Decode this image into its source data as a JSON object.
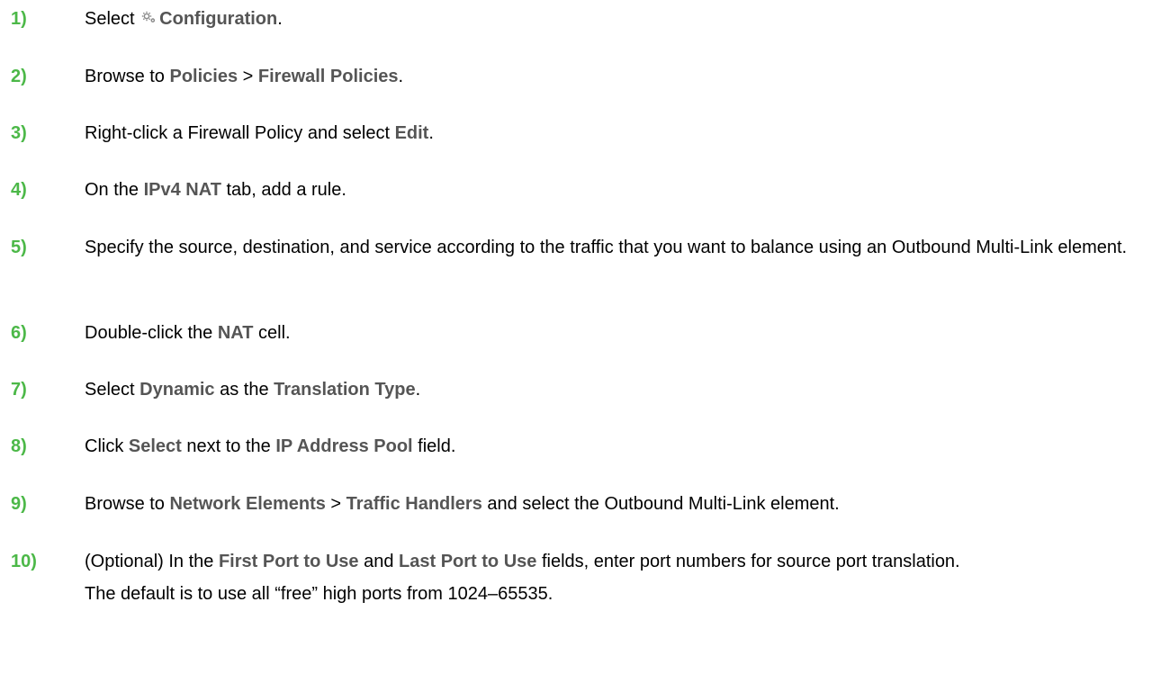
{
  "colors": {
    "step_number": "#4CB848",
    "ui_term": "#555555",
    "body_text": "#000000"
  },
  "steps": [
    {
      "number": "1)",
      "parts": [
        "Select ",
        "Configuration",
        "."
      ],
      "icon": "gear-icon"
    },
    {
      "number": "2)",
      "parts": [
        "Browse to ",
        "Policies",
        " > ",
        "Firewall Policies",
        "."
      ]
    },
    {
      "number": "3)",
      "parts": [
        "Right-click a Firewall Policy and select ",
        "Edit",
        "."
      ]
    },
    {
      "number": "4)",
      "parts": [
        "On the ",
        "IPv4 NAT",
        " tab, add a rule."
      ]
    },
    {
      "number": "5)",
      "parts": [
        "Specify the source, destination, and service according to the traffic that you want to balance using an Outbound Multi-Link element."
      ]
    },
    {
      "number": "6)",
      "parts": [
        "Double-click the ",
        "NAT",
        " cell."
      ]
    },
    {
      "number": "7)",
      "parts": [
        "Select ",
        "Dynamic",
        " as the ",
        "Translation Type",
        "."
      ]
    },
    {
      "number": "8)",
      "parts": [
        "Click ",
        "Select",
        " next to the ",
        "IP Address Pool",
        " field."
      ]
    },
    {
      "number": "9)",
      "parts": [
        "Browse to ",
        "Network Elements",
        " > ",
        "Traffic Handlers",
        " and select the Outbound Multi-Link element."
      ]
    },
    {
      "number": "10)",
      "parts": [
        "(Optional) In the ",
        "First Port to Use",
        " and ",
        "Last Port to Use",
        " fields, enter port numbers for source port translation."
      ],
      "note": "The default is to use all “free” high ports from 1024–65535."
    }
  ]
}
